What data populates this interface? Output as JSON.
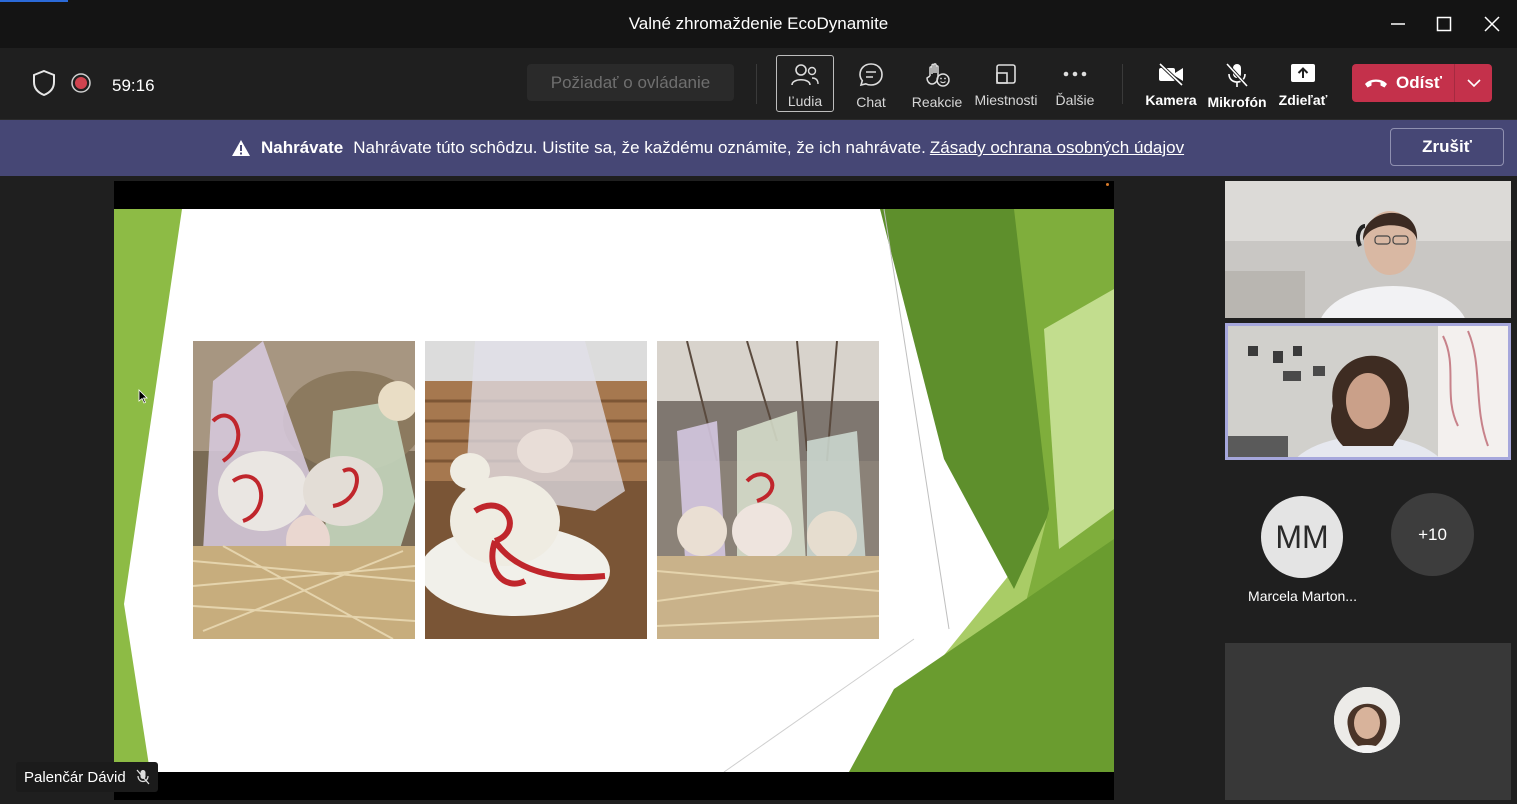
{
  "window": {
    "title": "Valné zhromaždenie EcoDynamite"
  },
  "toolbar": {
    "timer": "59:16",
    "request_control_label": "Požiadať o ovládanie",
    "buttons": [
      {
        "label": "Ľudia",
        "icon": "people-icon"
      },
      {
        "label": "Chat",
        "icon": "chat-icon"
      },
      {
        "label": "Reakcie",
        "icon": "reactions-icon"
      },
      {
        "label": "Miestnosti",
        "icon": "rooms-icon"
      },
      {
        "label": "Ďalšie",
        "icon": "more-icon"
      },
      {
        "label": "Kamera",
        "icon": "camera-off-icon"
      },
      {
        "label": "Mikrofón",
        "icon": "mic-off-icon"
      },
      {
        "label": "Zdieľať",
        "icon": "share-icon"
      }
    ],
    "leave_label": "Odísť"
  },
  "banner": {
    "title": "Nahrávate",
    "message": "Nahrávate túto schôdzu. Uistite sa, že každému oznámite, že ich nahrávate.",
    "link": "Zásady ochrana osobných údajov",
    "cancel_label": "Zrušiť"
  },
  "stage": {
    "presenter_name": "Palenčár Dávid"
  },
  "participants": {
    "initials": "MM",
    "name": "Marcela Marton...",
    "more_count": "+10"
  },
  "colors": {
    "leave": "#c4314b",
    "banner": "#464775",
    "active_speaker_border": "#a6a7dc",
    "slide_green": "#8dbb45"
  }
}
